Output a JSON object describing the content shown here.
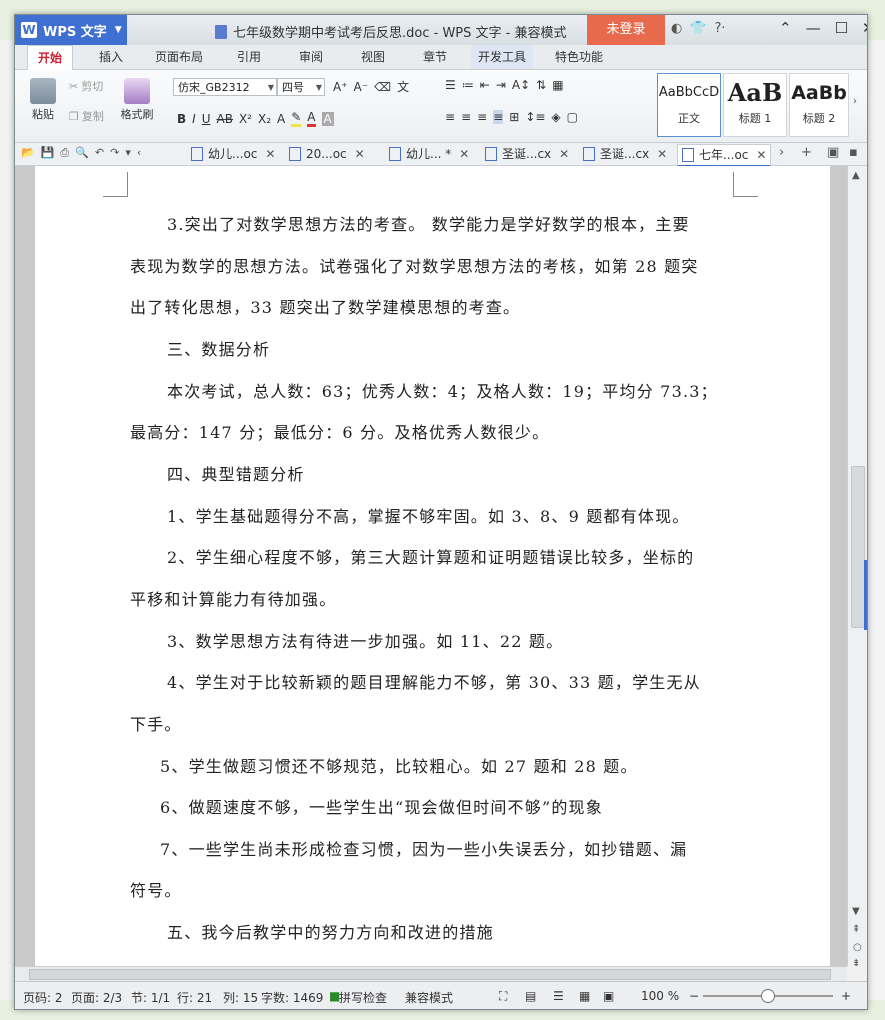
{
  "app": {
    "name": "WPS 文字",
    "window_title": "七年级数学期中考试考后反思.doc - WPS 文字 - 兼容模式",
    "login_label": "未登录"
  },
  "ribbon_tabs": [
    "开始",
    "插入",
    "页面布局",
    "引用",
    "审阅",
    "视图",
    "章节",
    "开发工具",
    "特色功能"
  ],
  "clipboard": {
    "paste": "粘贴",
    "cut": "剪切",
    "copy": "复制",
    "format_painter": "格式刷"
  },
  "font": {
    "name": "仿宋_GB2312",
    "size": "四号"
  },
  "styles": [
    {
      "sample": "AaBbCcD",
      "label": "正文"
    },
    {
      "sample": "AaB",
      "label": "标题 1"
    },
    {
      "sample": "AaBb",
      "label": "标题 2"
    }
  ],
  "doc_tabs": [
    {
      "label": "幼儿...oc",
      "active": false
    },
    {
      "label": "20...oc",
      "active": false
    },
    {
      "label": "幼儿... *",
      "active": false
    },
    {
      "label": "圣诞...cx",
      "active": false
    },
    {
      "label": "圣诞...cx",
      "active": false
    },
    {
      "label": "七年...oc",
      "active": true
    }
  ],
  "paragraphs": [
    "3.突出了对数学思想方法的考查。 数学能力是学好数学的根本，主要",
    "表现为数学的思想方法。试卷强化了对数学思想方法的考核，如第 28 题突",
    "出了转化思想，33 题突出了数学建模思想的考查。",
    "三、数据分析",
    "本次考试，总人数：63；优秀人数：4；及格人数：19；平均分 73.3；",
    "最高分：147 分；最低分：6 分。及格优秀人数很少。",
    "四、典型错题分析",
    "1、学生基础题得分不高，掌握不够牢固。如 3、8、9 题都有体现。",
    "2、学生细心程度不够，第三大题计算题和证明题错误比较多，坐标的",
    "平移和计算能力有待加强。",
    "3、数学思想方法有待进一步加强。如 11、22 题。",
    "4、学生对于比较新颖的题目理解能力不够，第 30、33 题，学生无从",
    "下手。",
    "5、学生做题习惯还不够规范，比较粗心。如 27 题和 28 题。",
    "6、做题速度不够，一些学生出“现会做但时间不够”的现象",
    "7、一些学生尚未形成检查习惯，因为一些小失误丢分，如抄错题、漏",
    "符号。",
    "五、我今后教学中的努力方向和改进的措施"
  ],
  "status": {
    "page_no": "页码: 2",
    "pages": "页面: 2/3",
    "section": "节: 1/1",
    "line": "行: 21",
    "column": "列: 15",
    "word_count": "字数: 1469",
    "spellcheck": "拼写检查",
    "mode": "兼容模式",
    "zoom": "100 %"
  },
  "colors": {
    "accent": "#3f6fd1",
    "login": "#e86a4c",
    "active_tab_text": "#cc2233"
  }
}
